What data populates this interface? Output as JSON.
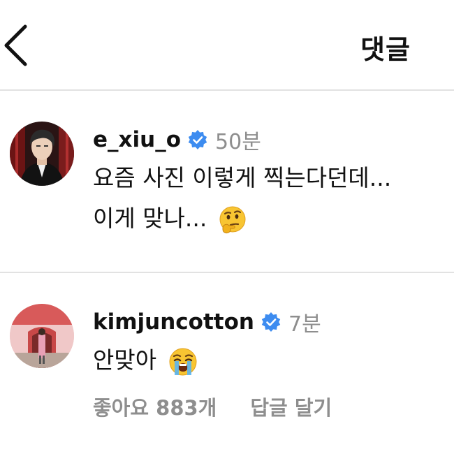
{
  "header": {
    "title": "댓글",
    "back_icon": "chevron-left-icon"
  },
  "colors": {
    "verified_badge": "#3d8cf0",
    "secondary_text": "#8e8e8e",
    "divider": "#e2e2e2"
  },
  "comments": [
    {
      "username": "e_xiu_o",
      "verified": true,
      "time": "50분",
      "text_line1": "요즘 사진 이렇게 찍는다던데...",
      "text_line2": "이게 맞나...",
      "emoji": "thinking-face-emoji"
    },
    {
      "username": "kimjuncotton",
      "verified": true,
      "time": "7분",
      "text_line1": "안맞아",
      "emoji": "loudly-crying-face-emoji",
      "likes_label": "좋아요 883개",
      "reply_label": "답글 달기"
    }
  ]
}
